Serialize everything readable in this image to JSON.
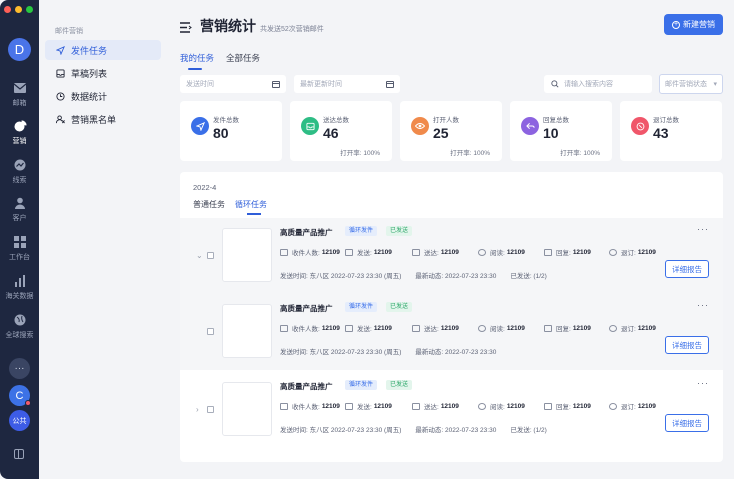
{
  "rail": {
    "avatar": "D",
    "items": [
      {
        "label": "邮箱"
      },
      {
        "label": "营销"
      },
      {
        "label": "线索"
      },
      {
        "label": "客户"
      },
      {
        "label": "工作台"
      },
      {
        "label": "海关数据"
      },
      {
        "label": "全球搜索"
      }
    ],
    "more": "···",
    "user": "C",
    "public": "公共"
  },
  "subnav": {
    "section": "邮件营销",
    "items": [
      {
        "label": "发件任务"
      },
      {
        "label": "草稿列表"
      },
      {
        "label": "数据统计"
      },
      {
        "label": "营销黑名单"
      }
    ]
  },
  "header": {
    "title": "营销统计",
    "subtitle": "共发送52次营销邮件",
    "new_button": "新建营销"
  },
  "tabs": [
    "我的任务",
    "全部任务"
  ],
  "filters": {
    "send_time": "发送时间",
    "update_time": "最新更新时间",
    "search_placeholder": "请输入搜索内容",
    "status_select": "邮件营销状态"
  },
  "stats": [
    {
      "label": "发件总数",
      "value": "80",
      "rate": ""
    },
    {
      "label": "送达总数",
      "value": "46",
      "rate": "打开率: 100%"
    },
    {
      "label": "打开人数",
      "value": "25",
      "rate": "打开率: 100%"
    },
    {
      "label": "回复总数",
      "value": "10",
      "rate": "打开率: 100%"
    },
    {
      "label": "退订总数",
      "value": "43",
      "rate": ""
    }
  ],
  "panel": {
    "date": "2022-4",
    "tabs": [
      "普通任务",
      "循环任务"
    ]
  },
  "tasks": [
    {
      "name": "高质量产品推广",
      "tag_loop": "循环发件",
      "tag_status": "已发送",
      "m_recv": "收件人数:",
      "v_recv": "12109",
      "m_sent": "发送:",
      "v_sent": "12109",
      "m_deliv": "送达:",
      "v_deliv": "12109",
      "m_read": "阅读:",
      "v_read": "12109",
      "m_reply": "回复:",
      "v_reply": "12109",
      "m_unsub": "退订:",
      "v_unsub": "12109",
      "send_time": "发送时间: 东八区 2022-07-23 23:30 (周五)",
      "latest": "最新动态: 2022-07-23 23:30",
      "progress": "已发送: (1/2)",
      "report": "详细报告"
    },
    {
      "name": "高质量产品推广",
      "tag_loop": "循环发件",
      "tag_status": "已发送",
      "m_recv": "收件人数:",
      "v_recv": "12109",
      "m_sent": "发送:",
      "v_sent": "12109",
      "m_deliv": "送达:",
      "v_deliv": "12109",
      "m_read": "阅读:",
      "v_read": "12109",
      "m_reply": "回复:",
      "v_reply": "12109",
      "m_unsub": "退订:",
      "v_unsub": "12109",
      "send_time": "发送时间: 东八区 2022-07-23 23:30 (周五)",
      "latest": "最新动态: 2022-07-23 23:30",
      "progress": "",
      "report": "详细报告"
    },
    {
      "name": "高质量产品推广",
      "tag_loop": "循环发件",
      "tag_status": "已发送",
      "m_recv": "收件人数:",
      "v_recv": "12109",
      "m_sent": "发送:",
      "v_sent": "12109",
      "m_deliv": "送达:",
      "v_deliv": "12109",
      "m_read": "阅读:",
      "v_read": "12109",
      "m_reply": "回复:",
      "v_reply": "12109",
      "m_unsub": "退订:",
      "v_unsub": "12109",
      "send_time": "发送时间: 东八区 2022-07-23 23:30 (周五)",
      "latest": "最新动态: 2022-07-23 23:30",
      "progress": "已发送: (1/2)",
      "report": "详细报告"
    }
  ],
  "colors": {
    "accent": "#3a6fe8",
    "rail_bg": "#1e2740",
    "stat_icons": [
      "#3a6fe8",
      "#2ebd85",
      "#f08a4b",
      "#8c63e0",
      "#f0566a"
    ]
  }
}
